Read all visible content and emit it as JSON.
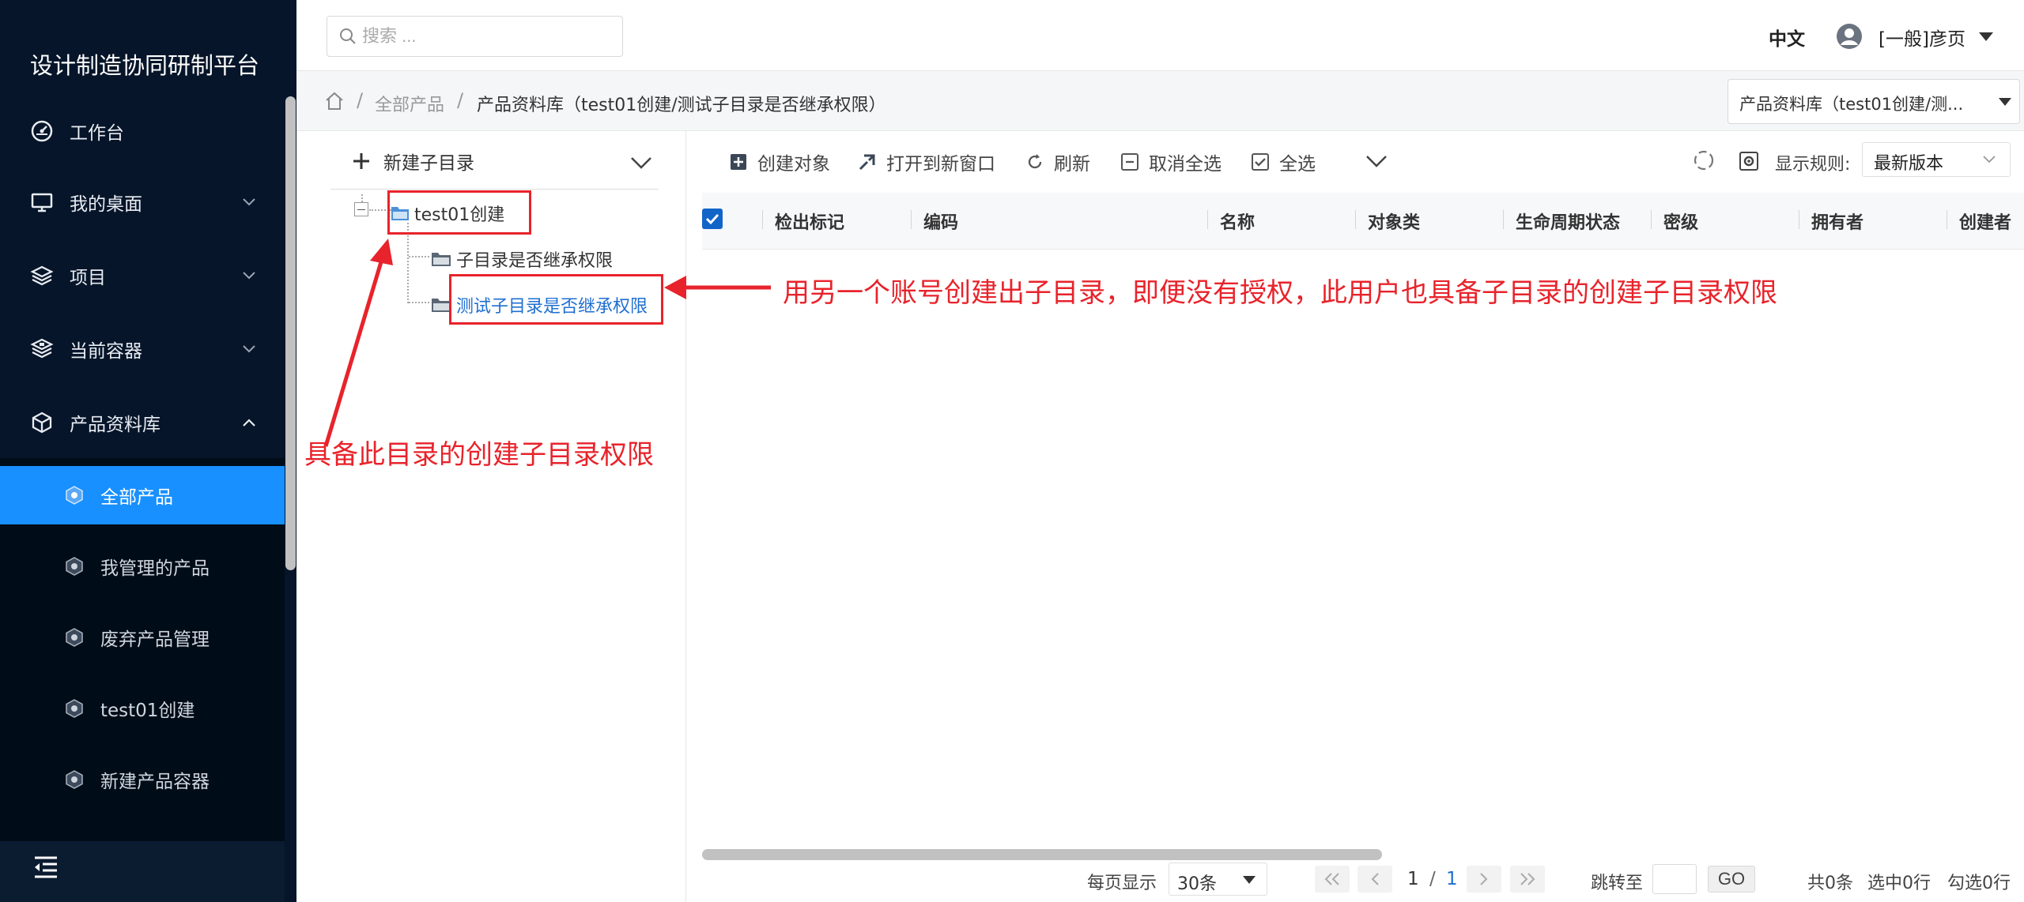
{
  "app": {
    "brand": "设计制造协同研制平台"
  },
  "sidebar": {
    "items": [
      {
        "label": "工作台",
        "icon": "dashboard-icon",
        "has_chevron": false
      },
      {
        "label": "我的桌面",
        "icon": "monitor-icon",
        "has_chevron": true
      },
      {
        "label": "项目",
        "icon": "layers-icon",
        "has_chevron": true
      },
      {
        "label": "当前容器",
        "icon": "layers-stack-icon",
        "has_chevron": true
      },
      {
        "label": "产品资料库",
        "icon": "cube-icon",
        "has_chevron": true,
        "expanded": true
      }
    ],
    "submenu": [
      {
        "label": "全部产品",
        "active": true
      },
      {
        "label": "我管理的产品",
        "active": false
      },
      {
        "label": "废弃产品管理",
        "active": false
      },
      {
        "label": "test01创建",
        "active": false
      },
      {
        "label": "新建产品容器",
        "active": false
      }
    ]
  },
  "topbar": {
    "search_placeholder": "搜索 ...",
    "language": "中文",
    "username": "[一般]彦页"
  },
  "breadcrumb": {
    "items": [
      "全部产品",
      "产品资料库（test01创建/测试子目录是否继承权限）"
    ],
    "separator": "/",
    "context_select": "产品资料库（test01创建/测..."
  },
  "tree": {
    "new_folder_label": "新建子目录",
    "root": "test01创建",
    "children": [
      "子目录是否继承权限",
      "测试子目录是否继承权限"
    ],
    "selected": "测试子目录是否继承权限"
  },
  "annotations": {
    "left_note": "具备此目录的创建子目录权限",
    "right_note": "用另一个账号创建出子目录，即便没有授权，此用户也具备子目录的创建子目录权限",
    "color": "#e8232b"
  },
  "toolbar": {
    "create_object": "创建对象",
    "open_new_window": "打开到新窗口",
    "refresh": "刷新",
    "deselect_all": "取消全选",
    "select_all": "全选",
    "display_rule_label": "显示规则:",
    "display_rule_value": "最新版本"
  },
  "table": {
    "columns": [
      "检出标记",
      "编码",
      "名称",
      "对象类",
      "生命周期状态",
      "密级",
      "拥有者",
      "创建者"
    ],
    "rows": []
  },
  "pagination": {
    "per_page_label": "每页显示",
    "per_page_value": "30条",
    "page_current": "1",
    "page_sep": "/",
    "page_total": "1",
    "jump_label": "跳转至",
    "go": "GO",
    "total": "共0条",
    "selected": "选中0行",
    "checked": "勾选0行"
  },
  "colors": {
    "sidebar_bg": "#061529",
    "submenu_bg": "#000c17",
    "active_blue": "#1890ff",
    "selection_blue": "#1f6fd1"
  }
}
